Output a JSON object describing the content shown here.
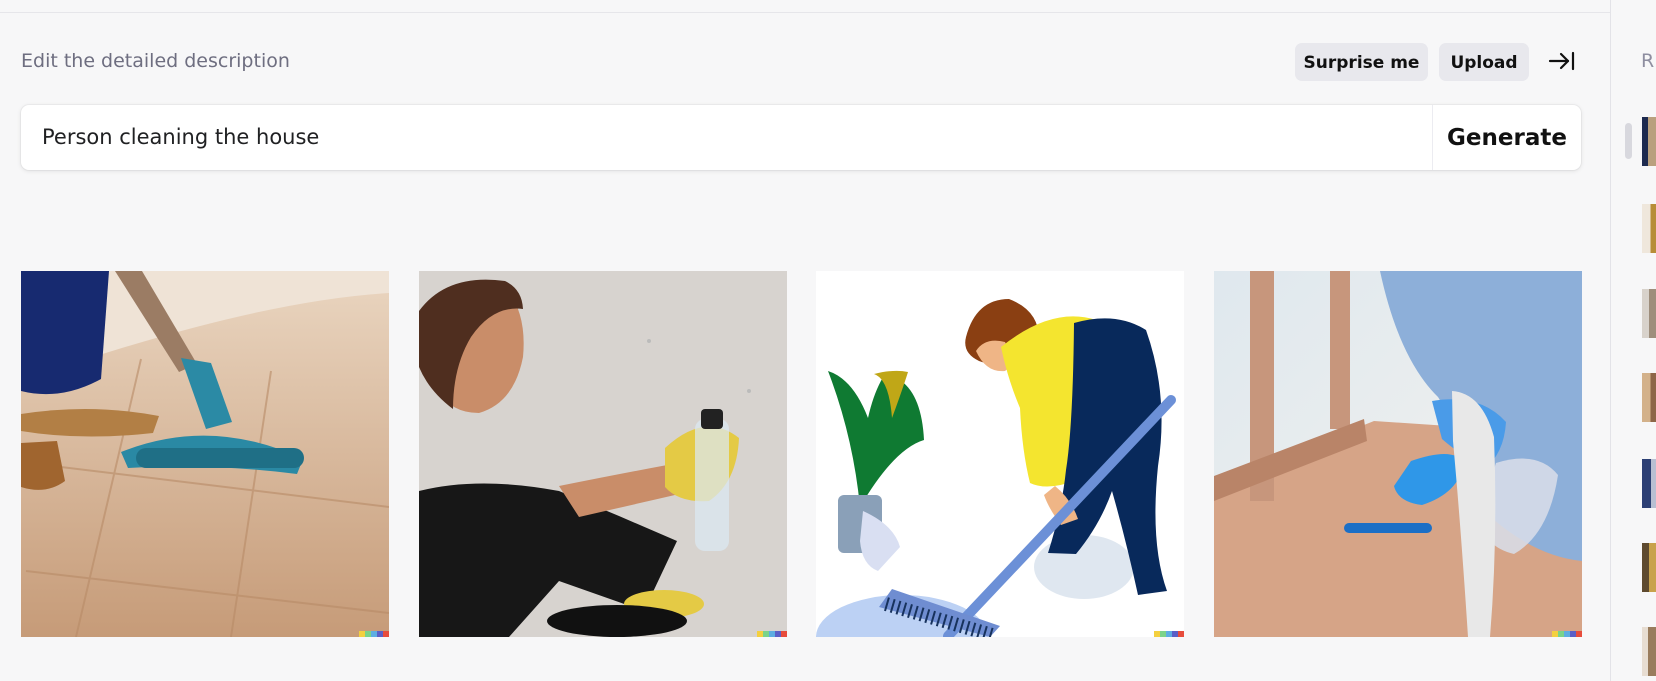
{
  "editor": {
    "heading": "Edit the detailed description",
    "surprise_label": "Surprise me",
    "upload_label": "Upload",
    "collapse_icon": "arrow-right-to-bar-icon",
    "prompt_value": "Person cleaning the house",
    "generate_label": "Generate"
  },
  "results": [
    {
      "name": "floor-mop-photo"
    },
    {
      "name": "woman-cleaning-wall-photo"
    },
    {
      "name": "illustrated-person-sweeping"
    },
    {
      "name": "gloved-person-wiping-table-photo"
    }
  ],
  "watermark_colors": [
    "#f4d03f",
    "#7bd389",
    "#5dade2",
    "#5b5fc7",
    "#e74c3c"
  ],
  "side_panel": {
    "label": "R",
    "thumbnail_count": 7
  }
}
